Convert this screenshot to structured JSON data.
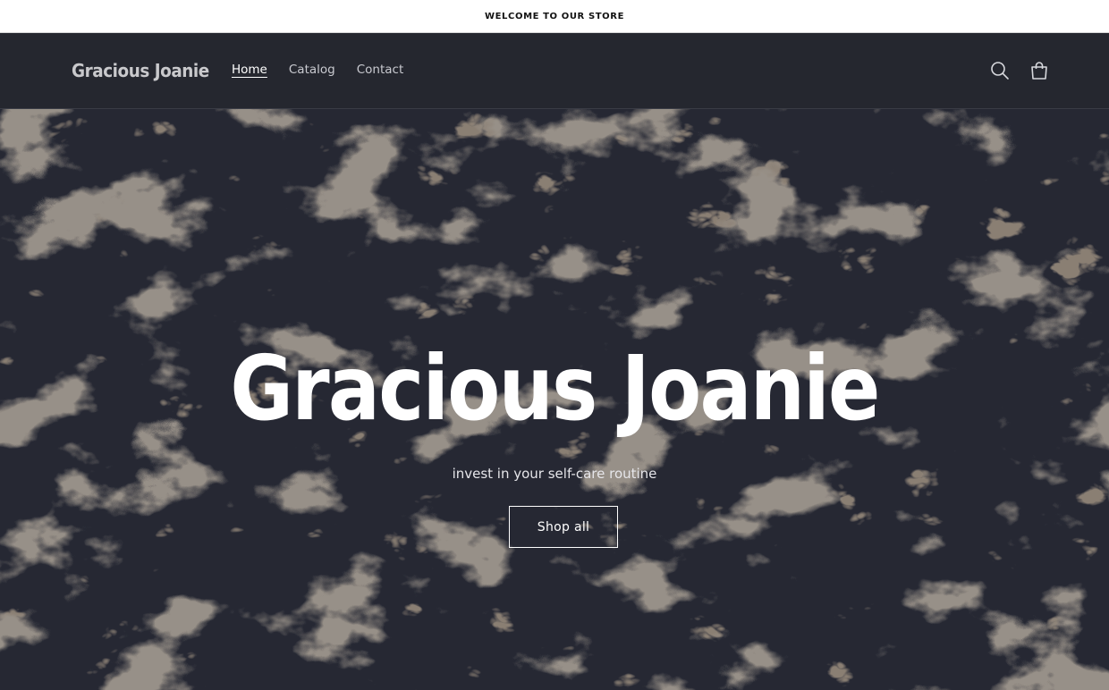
{
  "announcement": {
    "text": "Welcome to our store"
  },
  "header": {
    "logo": "Gracious Joanie",
    "nav": [
      {
        "label": "Home",
        "active": true
      },
      {
        "label": "Catalog",
        "active": false
      },
      {
        "label": "Contact",
        "active": false
      }
    ],
    "icons": {
      "search": "search-icon",
      "cart": "cart-icon"
    }
  },
  "hero": {
    "title": "Gracious Joanie",
    "subtitle": "invest in your self-care routine",
    "button_label": "Shop all"
  },
  "colors": {
    "header_bg": "#25272f",
    "hero_bg": "#282a35",
    "marble_gold": "#b09a7c",
    "text_light": "#ffffff"
  }
}
